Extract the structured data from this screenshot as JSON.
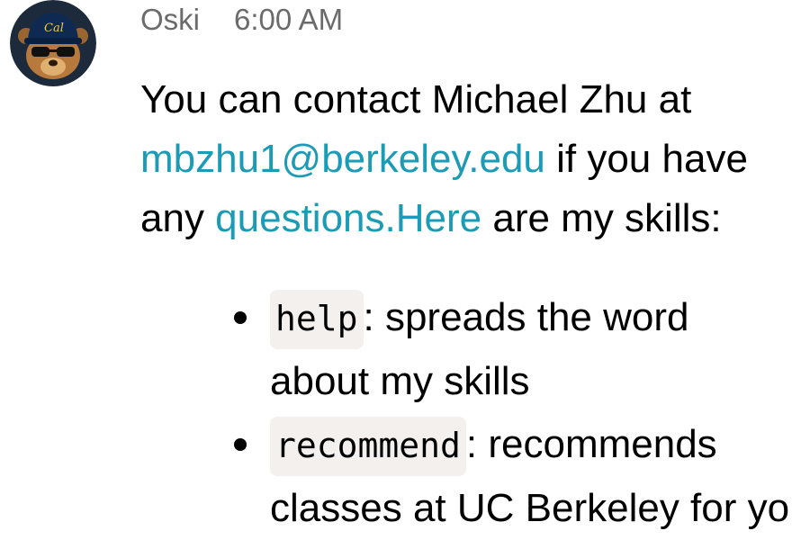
{
  "message": {
    "sender": "Oski",
    "timestamp": "6:00 AM",
    "avatar_icon": "oski-bear-avatar-icon",
    "avatar_colors": {
      "background": "#1d2a3c",
      "cap": "#0e2a52",
      "cap_logo": "#f2c34b",
      "face": "#b87a3c",
      "sunglasses": "#111111"
    },
    "text_line1": "You can contact Michael Zhu at",
    "email_link": "mbzhu1@berkeley.edu",
    "text_after_email": " if you have",
    "text_line3_start": "any ",
    "questions_link": "questions.Here",
    "text_line3_end": " are my skills:",
    "link_color": "#1b9bb5"
  },
  "skills": [
    {
      "command": "help",
      "line1": ": spreads the word",
      "line2": "about my skills"
    },
    {
      "command": "recommend",
      "line1": ": recommends",
      "line2": "classes at UC Berkeley for yo"
    }
  ]
}
